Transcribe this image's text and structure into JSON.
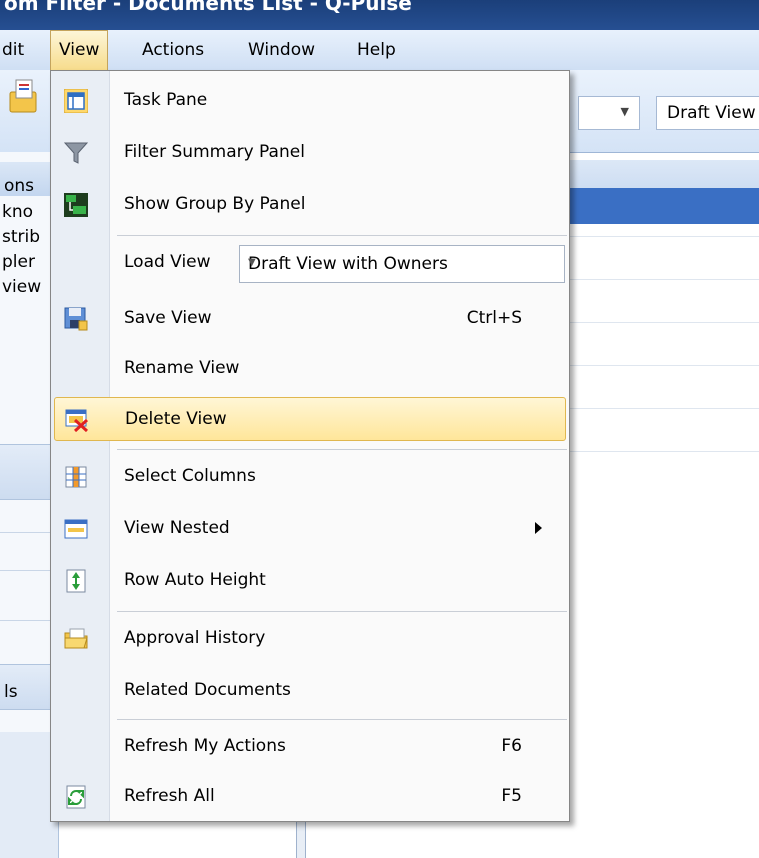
{
  "window": {
    "title": "om Filter - Documents List - Q-Pulse"
  },
  "menubar": {
    "items": [
      "dit",
      "View",
      "Actions",
      "Window",
      "Help"
    ],
    "active": "View"
  },
  "toolbar": {
    "view_combo_value": "Draft View"
  },
  "left_panel": {
    "header": "ons",
    "rows": [
      "kno",
      "strib",
      "pler",
      "view"
    ],
    "bottom_label": "ls"
  },
  "menu": {
    "task_pane": "Task Pane",
    "filter_summary": "Filter Summary Panel",
    "group_by": "Show Group By Panel",
    "load_view": "Load View",
    "load_view_value": "Draft View with Owners",
    "save_view": "Save View",
    "save_view_shortcut": "Ctrl+S",
    "rename_view": "Rename View",
    "delete_view": "Delete View",
    "select_columns": "Select Columns",
    "view_nested": "View Nested",
    "row_auto_height": "Row Auto Height",
    "approval_history": "Approval History",
    "related_documents": "Related Documents",
    "refresh_my_actions": "Refresh My Actions",
    "refresh_my_actions_shortcut": "F6",
    "refresh_all": "Refresh All",
    "refresh_all_shortcut": "F5",
    "highlighted": "Delete View"
  },
  "icons": {
    "task_pane": "task-pane-icon",
    "filter": "filter-icon",
    "group_by": "group-by-icon",
    "save": "save-view-icon",
    "delete": "delete-view-icon",
    "columns": "select-columns-icon",
    "nested": "view-nested-icon",
    "row_height": "row-auto-height-icon",
    "approval": "approval-history-icon",
    "refresh": "refresh-all-icon"
  },
  "colors": {
    "highlight": "#ffe69a",
    "titlebar": "#1b3f7a",
    "selection": "#3a6fc4"
  }
}
